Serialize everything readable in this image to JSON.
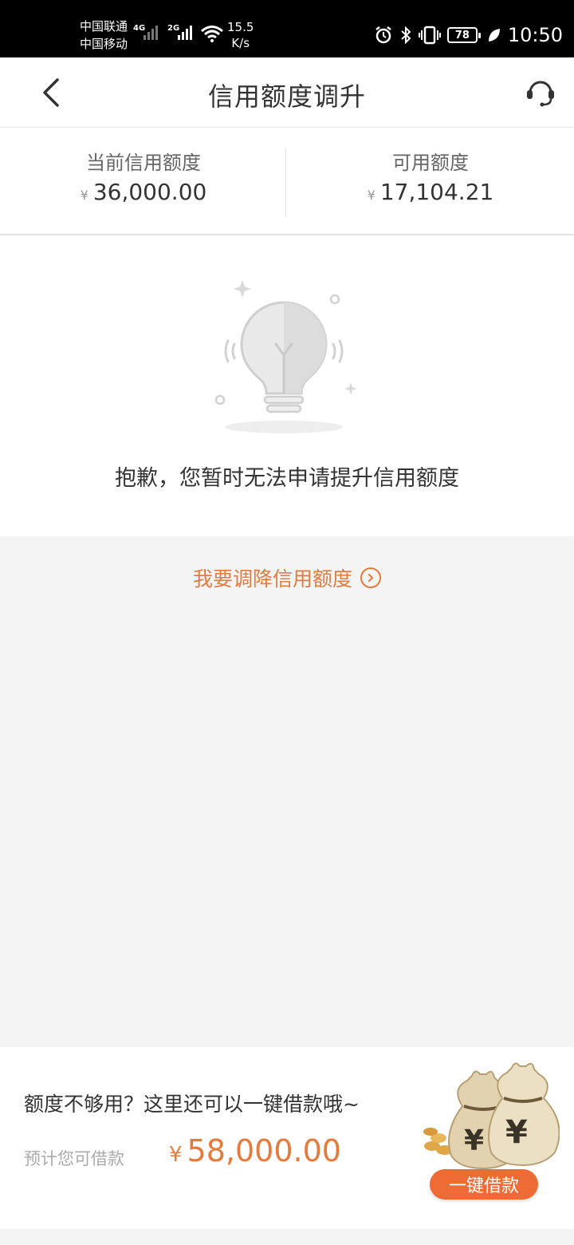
{
  "status_bar": {
    "carrier_1": "中国联通",
    "carrier_2": "中国移动",
    "net_1": "4G",
    "net_2": "2G",
    "speed_value": "15.5",
    "speed_unit": "K/s",
    "battery": "78",
    "time": "10:50"
  },
  "nav": {
    "title": "信用额度调升",
    "back_icon": "chevron-left-icon",
    "service_icon": "headset-icon"
  },
  "summary": {
    "current_label": "当前信用额度",
    "current_currency": "¥",
    "current_value": "36,000.00",
    "available_label": "可用额度",
    "available_currency": "¥",
    "available_value": "17,104.21"
  },
  "empty_state": {
    "icon": "lightbulb-icon",
    "message": "抱歉，您暂时无法申请提升信用额度"
  },
  "reduce_link": {
    "label": "我要调降信用额度",
    "icon": "circle-chevron-right-icon"
  },
  "loan_card": {
    "promo": "额度不够用？这里还可以一键借款哦~",
    "estimate_label": "预计您可借款",
    "currency": "¥",
    "amount": "58,000.00",
    "button_label": "一键借款",
    "image": "money-bags-illustration"
  },
  "colors": {
    "accent": "#e47a3c",
    "button": "#ee6b35",
    "page_bg": "#f4f4f4"
  }
}
